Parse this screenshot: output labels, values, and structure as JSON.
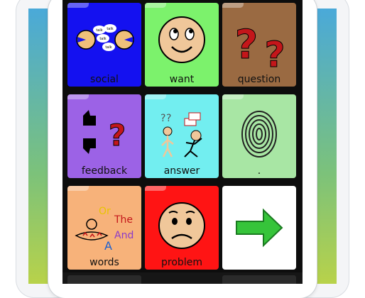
{
  "app": {
    "tiles": [
      {
        "id": "social",
        "label": "social",
        "color": "#1411f0",
        "icon": "people-talking-icon"
      },
      {
        "id": "want",
        "label": "want",
        "color": "#7cf26c",
        "icon": "smiley-face-icon"
      },
      {
        "id": "question",
        "label": "question",
        "color": "#9a6a42",
        "icon": "question-marks-icon"
      },
      {
        "id": "feedback",
        "label": "feedback",
        "color": "#9c62e6",
        "icon": "thumbs-up-down-icon"
      },
      {
        "id": "answer",
        "label": "answer",
        "color": "#72eef0",
        "icon": "people-answer-icon"
      },
      {
        "id": "dot",
        "label": ".",
        "color": "#a8e6a4",
        "icon": "fingerprint-icon"
      },
      {
        "id": "words",
        "label": "words",
        "color": "#f7b27a",
        "icon": "words-icon"
      },
      {
        "id": "problem",
        "label": "problem",
        "color": "#ff1414",
        "icon": "worried-face-icon"
      },
      {
        "id": "next",
        "label": "",
        "color": "#ffffff",
        "icon": "arrow-right-icon"
      }
    ],
    "art_text": {
      "talk1": "talk",
      "talk2": "talk",
      "talk3": "talk",
      "talk4": "talk",
      "or": "Or",
      "the": "The",
      "and": "And",
      "a": "A",
      "qmark": "?"
    }
  }
}
